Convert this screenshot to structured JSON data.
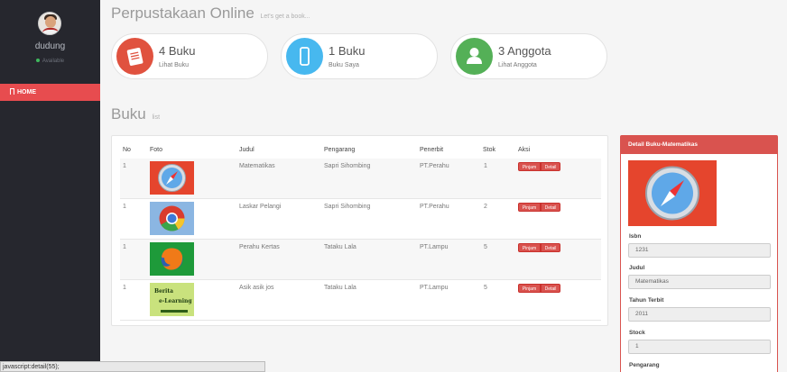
{
  "sidebar": {
    "user_name": "dudung",
    "user_status": "Available",
    "nav_home": "HOME"
  },
  "header": {
    "title": "Perpustakaan Online",
    "subtitle": "Let's get a book..."
  },
  "stats": [
    {
      "value": "4 Buku",
      "label": "Lihat Buku",
      "icon": "book-icon",
      "color": "#e0523f"
    },
    {
      "value": "1 Buku",
      "label": "Buku Saya",
      "icon": "phone-icon",
      "color": "#47b8ef"
    },
    {
      "value": "3 Anggota",
      "label": "Lihat Anggota",
      "icon": "user-icon",
      "color": "#54b057"
    }
  ],
  "section": {
    "title": "Buku",
    "subtitle": "list"
  },
  "table": {
    "headers": [
      "No",
      "Foto",
      "Judul",
      "Pengarang",
      "Penerbit",
      "Stok",
      "Aksi"
    ],
    "rows": [
      {
        "no": "1",
        "judul": "Matematikas",
        "pengarang": "Sapri Sihombing",
        "penerbit": "PT.Perahu",
        "stok": "1",
        "image": "safari-icon"
      },
      {
        "no": "1",
        "judul": "Laskar Pelangi",
        "pengarang": "Sapri Sihombing",
        "penerbit": "PT.Perahu",
        "stok": "2",
        "image": "chrome-icon"
      },
      {
        "no": "1",
        "judul": "Perahu Kertas",
        "pengarang": "Tataku Lala",
        "penerbit": "PT.Lampu",
        "stok": "5",
        "image": "firefox-icon"
      },
      {
        "no": "1",
        "judul": "Asik asik jos",
        "pengarang": "Tataku Lala",
        "penerbit": "PT.Lampu",
        "stok": "5",
        "image": "elearning-image"
      }
    ],
    "btn_pinjam": "Pinjam",
    "btn_detail": "Detail",
    "elearning_text1": "Berita",
    "elearning_text2": "e-Learning"
  },
  "detail": {
    "title": "Detail Buku-Matematikas",
    "fields": [
      {
        "label": "Isbn",
        "value": "1231"
      },
      {
        "label": "Judul",
        "value": "Matematikas"
      },
      {
        "label": "Tahun Terbit",
        "value": "2011"
      },
      {
        "label": "Stock",
        "value": "1"
      },
      {
        "label": "Pengarang",
        "value": ""
      }
    ]
  },
  "statusbar": {
    "text": "javascript:detail(55);"
  },
  "colors": {
    "sidebar_bg": "#26272e",
    "accent_red": "#e74c4f",
    "button_red": "#d9534f"
  }
}
